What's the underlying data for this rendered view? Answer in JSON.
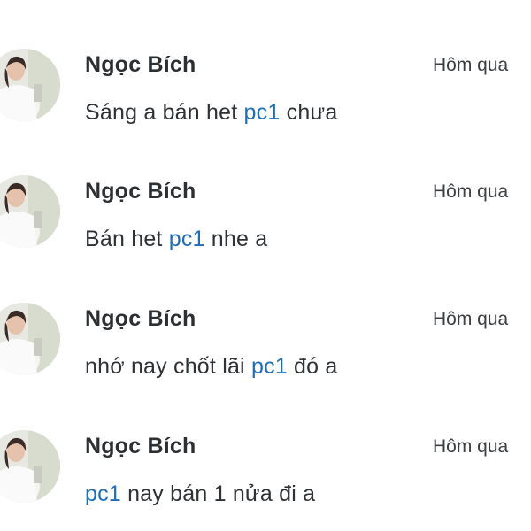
{
  "colors": {
    "background": "#ffffff",
    "name_text": "#2d3033",
    "message_text": "#2f3235",
    "tag_link": "#1f6fb8"
  },
  "messages": [
    {
      "avatar_icon": "user-avatar-photo",
      "sender": "Ngọc Bích",
      "time": "Hôm qua",
      "pre": "Sáng a bán het ",
      "tag": "pc1",
      "post": " chưa"
    },
    {
      "avatar_icon": "user-avatar-photo",
      "sender": "Ngọc Bích",
      "time": "Hôm qua",
      "pre": "Bán het ",
      "tag": "pc1",
      "post": " nhe a"
    },
    {
      "avatar_icon": "user-avatar-photo",
      "sender": "Ngọc Bích",
      "time": "Hôm qua",
      "pre": "nhớ nay chốt lãi ",
      "tag": "pc1",
      "post": " đó a"
    },
    {
      "avatar_icon": "user-avatar-photo",
      "sender": "Ngọc Bích",
      "time": "Hôm qua",
      "pre": "",
      "tag": "pc1",
      "post": " nay bán 1 nửa đi a"
    }
  ]
}
